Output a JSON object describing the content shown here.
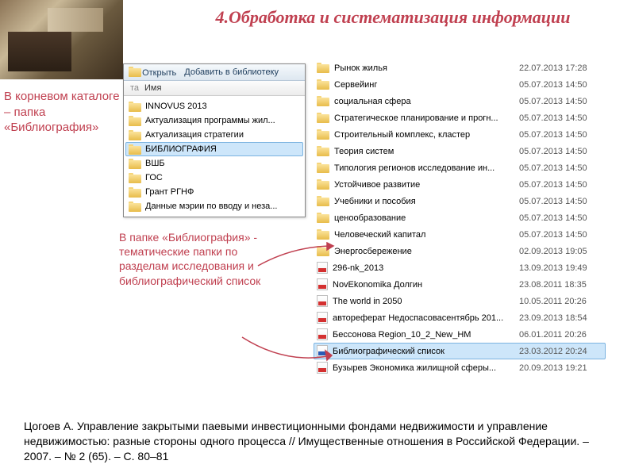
{
  "title": "4.Обработка и систематизация информации",
  "caption1": "В корневом каталоге – папка «Библиография»",
  "caption2": "В папке «Библиография» - тематические папки по разделам исследования и библиографический список",
  "citation": "Цогоев А. Управление закрытыми паевыми инвестиционными фондами недвижимости и управление недвижимостью: разные стороны одного процесса // Имущественные отношения в Российской Федерации. – 2007. – № 2 (65). – С. 80–81",
  "explorer1": {
    "toolbar": {
      "open": "Открыть",
      "add": "Добавить в библиотеку"
    },
    "column": "Имя",
    "sidebar_hint": "та",
    "items": [
      {
        "icon": "folder",
        "name": "INNOVUS 2013"
      },
      {
        "icon": "folder",
        "name": "Актуализация программы жил..."
      },
      {
        "icon": "folder",
        "name": "Актуализация стратегии"
      },
      {
        "icon": "folder",
        "name": "БИБЛИОГРАФИЯ",
        "selected": true
      },
      {
        "icon": "folder",
        "name": "ВШБ"
      },
      {
        "icon": "folder",
        "name": "ГОС"
      },
      {
        "icon": "folder",
        "name": "Грант РГНФ"
      },
      {
        "icon": "folder",
        "name": "Данные мэрии по вводу и неза..."
      }
    ]
  },
  "explorer2": {
    "items": [
      {
        "icon": "folder",
        "name": "Рынок жилья",
        "date": "22.07.2013 17:28"
      },
      {
        "icon": "folder",
        "name": "Сервейинг",
        "date": "05.07.2013 14:50"
      },
      {
        "icon": "folder",
        "name": "социальная сфера",
        "date": "05.07.2013 14:50"
      },
      {
        "icon": "folder",
        "name": "Стратегическое планирование и прогн...",
        "date": "05.07.2013 14:50"
      },
      {
        "icon": "folder",
        "name": "Строительный комплекс, кластер",
        "date": "05.07.2013 14:50"
      },
      {
        "icon": "folder",
        "name": "Теория систем",
        "date": "05.07.2013 14:50"
      },
      {
        "icon": "folder",
        "name": "Типология регионов исследование ин...",
        "date": "05.07.2013 14:50"
      },
      {
        "icon": "folder",
        "name": "Устойчивое развитие",
        "date": "05.07.2013 14:50"
      },
      {
        "icon": "folder",
        "name": "Учебники и пособия",
        "date": "05.07.2013 14:50"
      },
      {
        "icon": "folder",
        "name": "ценообразование",
        "date": "05.07.2013 14:50"
      },
      {
        "icon": "folder",
        "name": "Человеческий капитал",
        "date": "05.07.2013 14:50"
      },
      {
        "icon": "folder",
        "name": "Энергосбережение",
        "date": "02.09.2013 19:05"
      },
      {
        "icon": "pdf",
        "name": "296-nk_2013",
        "date": "13.09.2013 19:49"
      },
      {
        "icon": "pdf",
        "name": "NovEkonomika Долгин",
        "date": "23.08.2011 18:35"
      },
      {
        "icon": "pdf",
        "name": "The world in 2050",
        "date": "10.05.2011 20:26"
      },
      {
        "icon": "pdf",
        "name": "автореферат Недоспасовасентябрь 201...",
        "date": "23.09.2013 18:54"
      },
      {
        "icon": "pdf",
        "name": "Бессонова Region_10_2_New_HM",
        "date": "06.01.2011 20:26"
      },
      {
        "icon": "doc",
        "name": "Библиографический список",
        "date": "23.03.2012 20:24",
        "selected": true
      },
      {
        "icon": "pdf",
        "name": "Бузырев Экономика жилищной сферы...",
        "date": "20.09.2013 19:21"
      }
    ]
  }
}
